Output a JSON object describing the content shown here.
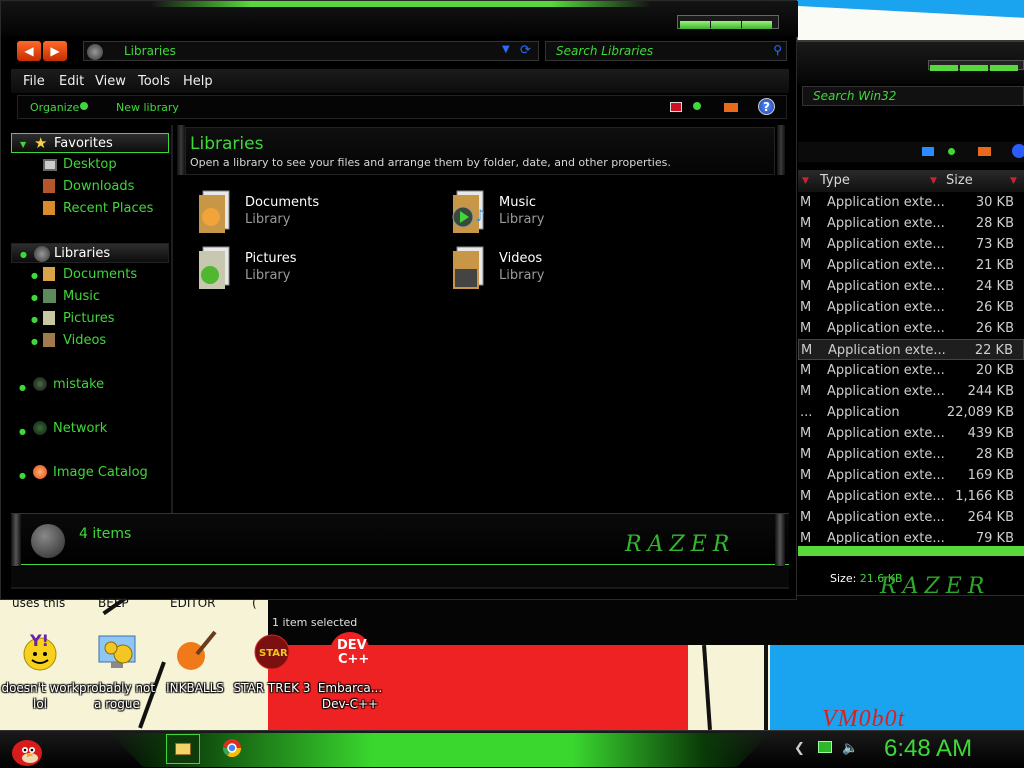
{
  "explorer": {
    "address": "Libraries",
    "search_placeholder": "Search Libraries",
    "menu": [
      "File",
      "Edit",
      "View",
      "Tools",
      "Help"
    ],
    "command_bar": {
      "organize": "Organize",
      "new_library": "New library"
    },
    "nav": {
      "favorites": "Favorites",
      "favorites_items": [
        "Desktop",
        "Downloads",
        "Recent Places"
      ],
      "libraries": "Libraries",
      "libraries_items": [
        "Documents",
        "Music",
        "Pictures",
        "Videos"
      ],
      "others": [
        "mistake",
        "Network",
        "Image Catalog"
      ]
    },
    "content": {
      "title": "Libraries",
      "subtitle": "Open a library to see your files and arrange them by folder, date, and other properties.",
      "libraries": [
        {
          "name": "Documents",
          "type": "Library"
        },
        {
          "name": "Music",
          "type": "Library"
        },
        {
          "name": "Pictures",
          "type": "Library"
        },
        {
          "name": "Videos",
          "type": "Library"
        }
      ]
    },
    "details": {
      "count": "4 items",
      "brand": "RAZER"
    }
  },
  "background_window": {
    "search_placeholder": "Search Win32",
    "columns": [
      "Type",
      "Size"
    ],
    "rows": [
      {
        "c0": "M",
        "type": "Application exte...",
        "size": "30 KB"
      },
      {
        "c0": "M",
        "type": "Application exte...",
        "size": "28 KB"
      },
      {
        "c0": "M",
        "type": "Application exte...",
        "size": "73 KB"
      },
      {
        "c0": "M",
        "type": "Application exte...",
        "size": "21 KB"
      },
      {
        "c0": "M",
        "type": "Application exte...",
        "size": "24 KB"
      },
      {
        "c0": "M",
        "type": "Application exte...",
        "size": "26 KB"
      },
      {
        "c0": "M",
        "type": "Application exte...",
        "size": "26 KB"
      },
      {
        "c0": "M",
        "type": "Application exte...",
        "size": "22 KB"
      },
      {
        "c0": "M",
        "type": "Application exte...",
        "size": "20 KB"
      },
      {
        "c0": "M",
        "type": "Application exte...",
        "size": "244 KB"
      },
      {
        "c0": "...",
        "type": "Application",
        "size": "22,089 KB"
      },
      {
        "c0": "M",
        "type": "Application exte...",
        "size": "439 KB"
      },
      {
        "c0": "M",
        "type": "Application exte...",
        "size": "28 KB"
      },
      {
        "c0": "M",
        "type": "Application exte...",
        "size": "169 KB"
      },
      {
        "c0": "M",
        "type": "Application exte...",
        "size": "1,166 KB"
      },
      {
        "c0": "M",
        "type": "Application exte...",
        "size": "264 KB"
      },
      {
        "c0": "M",
        "type": "Application exte...",
        "size": "79 KB"
      }
    ],
    "selected_row": 7,
    "size_label": "Size:",
    "size_value": "21.6 KB",
    "status": "1 item selected",
    "brand": "RAZER"
  },
  "desktop": {
    "top_captions": [
      "uses this",
      "BEEP",
      "EDITOR",
      "("
    ],
    "icons": [
      {
        "label": "doesn't work lol",
        "icon": "yahoo-messenger-icon"
      },
      {
        "label": "probably not a rogue",
        "icon": "gears-monitor-icon"
      },
      {
        "label": "INKBALLS",
        "icon": "inkball-icon"
      },
      {
        "label": "STAR TREK 3",
        "icon": "star-trek-icon"
      },
      {
        "label": "Embarca... Dev-C++",
        "icon": "dev-cpp-icon"
      }
    ],
    "wallpaper_text": "VM0b0t"
  },
  "taskbar": {
    "clock": "6:48 AM"
  },
  "colors": {
    "accent": "#3fd83a",
    "background": "#000000",
    "taskbar_glow": "#3ad82f"
  }
}
